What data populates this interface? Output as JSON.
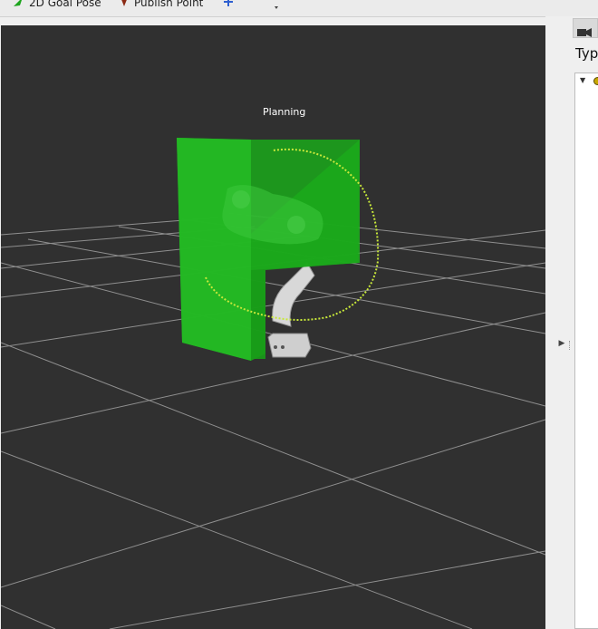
{
  "toolbar": {
    "goal_pose_label": "2D Goal Pose",
    "publish_point_label": "Publish Point",
    "goal_pose_icon": "green-arrow-icon",
    "publish_point_icon": "red-pin-icon",
    "add_icon": "plus-icon",
    "remove_icon": "minus-icon"
  },
  "viewport": {
    "background": "#303030",
    "grid_color": "#a0a0a0",
    "planning_label": "Planning",
    "wall_color": "#1fb31f",
    "trajectory_color": "#c8e83a"
  },
  "side_panel": {
    "type_label": "Typ",
    "camera_icon": "camera-icon"
  }
}
